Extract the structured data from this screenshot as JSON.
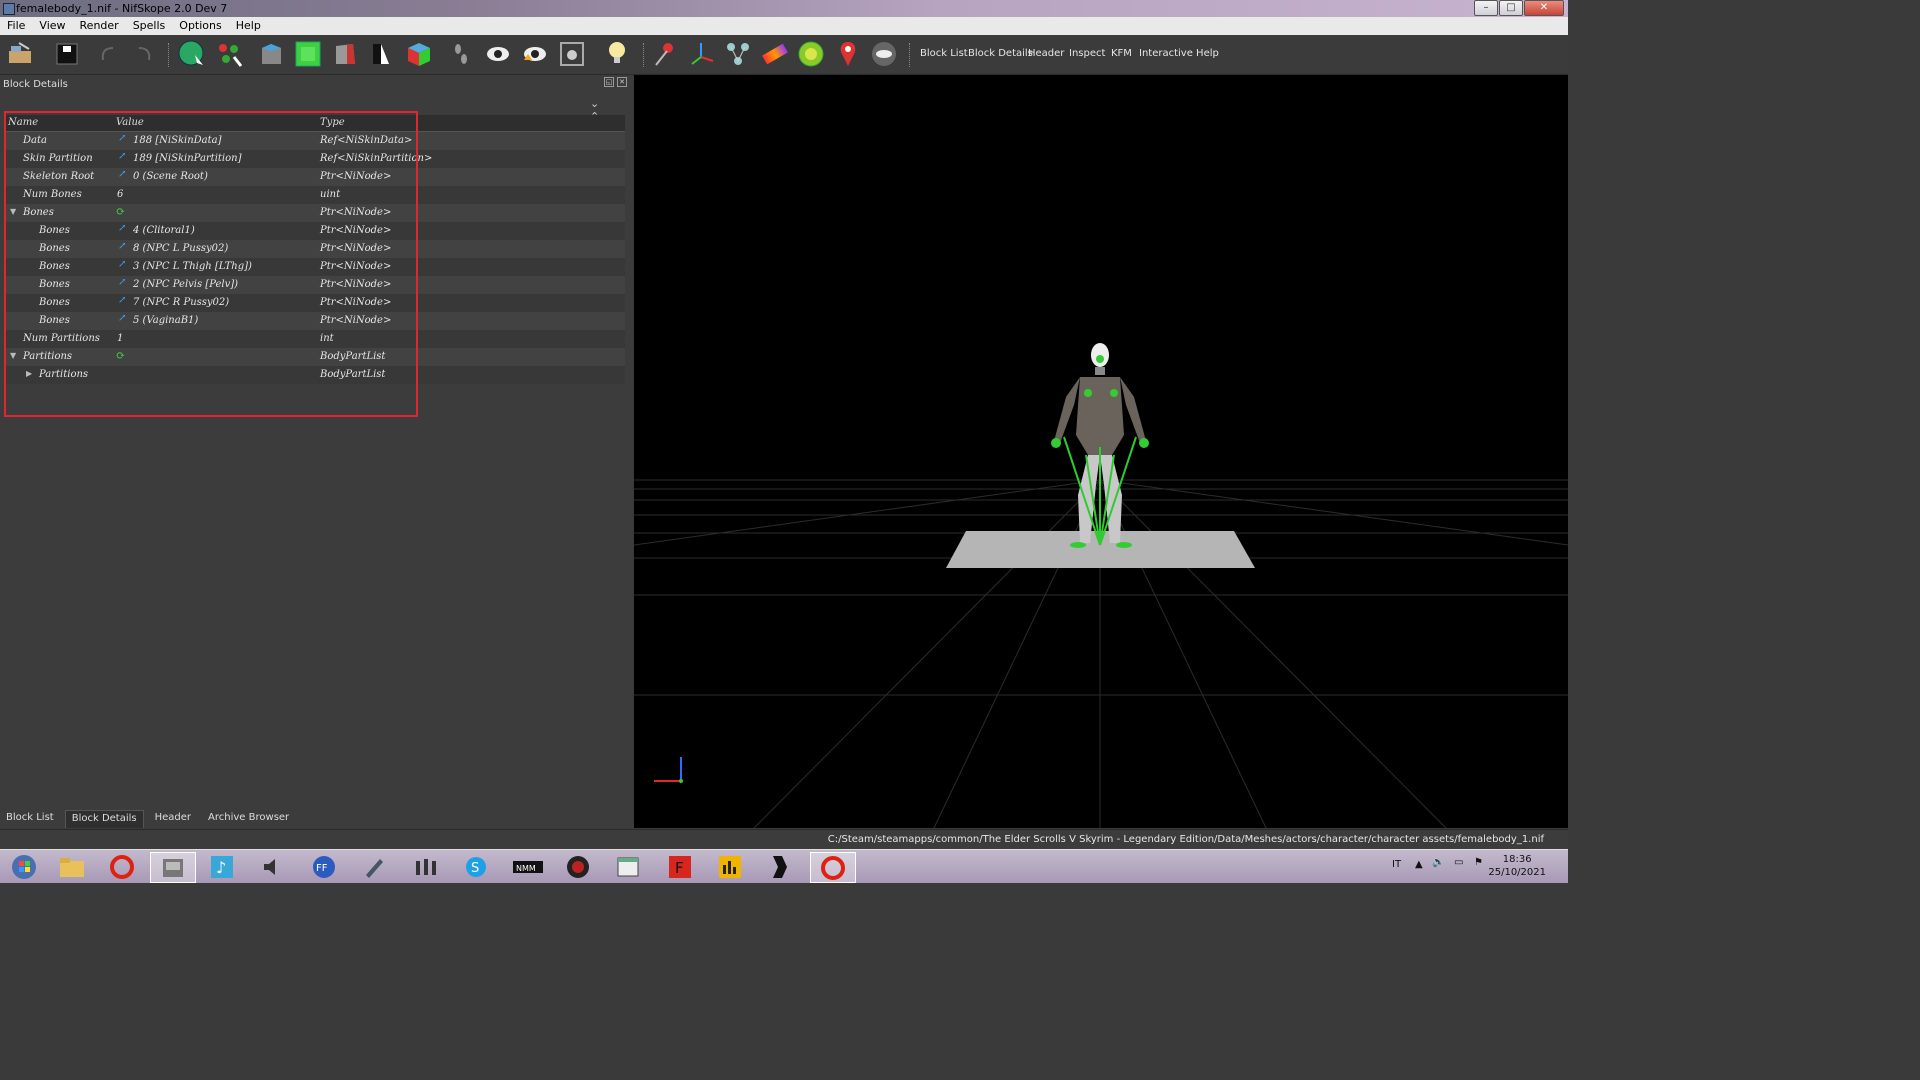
{
  "window": {
    "title": "femalebody_1.nif - NifSkope 2.0 Dev 7"
  },
  "menu": [
    "File",
    "View",
    "Render",
    "Spells",
    "Options",
    "Help"
  ],
  "toolbar": {
    "icons": [
      "load-icon",
      "save-icon",
      "undo-icon",
      "redo-icon",
      "select-object-icon",
      "select-vertex-icon",
      "cube-blue-icon",
      "cube-green-icon",
      "cube-red-icon",
      "lightning-icon",
      "cube-color-icon",
      "footprints-icon",
      "eye-icon",
      "eye-orange-icon",
      "camera-icon",
      "light-bulb-icon",
      "pin-icon",
      "axes-icon",
      "nodes-icon",
      "gradient-icon",
      "sphere-icon",
      "marker-icon",
      "visibility-icon"
    ],
    "links": [
      "Block List",
      "Block Details",
      "Header",
      "Inspect",
      "KFM",
      "Interactive Help"
    ]
  },
  "panel": {
    "title": "Block Details",
    "columns": {
      "name": "Name",
      "value": "Value",
      "type": "Type"
    },
    "rows": [
      {
        "name": "Data",
        "value": "188 [NiSkinData]",
        "type": "Ref<NiSkinData>",
        "icon": "link",
        "depth": 0
      },
      {
        "name": "Skin Partition",
        "value": "189 [NiSkinPartition]",
        "type": "Ref<NiSkinPartition>",
        "icon": "link",
        "depth": 0
      },
      {
        "name": "Skeleton Root",
        "value": "0 (Scene Root)",
        "type": "Ptr<NiNode>",
        "icon": "link",
        "depth": 0
      },
      {
        "name": "Num Bones",
        "value": "6",
        "type": "uint",
        "icon": "",
        "depth": 0
      },
      {
        "name": "Bones",
        "value": "",
        "type": "Ptr<NiNode>",
        "icon": "refresh",
        "depth": 0,
        "expanded": "open"
      },
      {
        "name": "Bones",
        "value": "4 (Clitoral1)",
        "type": "Ptr<NiNode>",
        "icon": "link",
        "depth": 1
      },
      {
        "name": "Bones",
        "value": "8 (NPC L Pussy02)",
        "type": "Ptr<NiNode>",
        "icon": "link",
        "depth": 1
      },
      {
        "name": "Bones",
        "value": "3 (NPC L Thigh [LThg])",
        "type": "Ptr<NiNode>",
        "icon": "link",
        "depth": 1
      },
      {
        "name": "Bones",
        "value": "2 (NPC Pelvis [Pelv])",
        "type": "Ptr<NiNode>",
        "icon": "link",
        "depth": 1
      },
      {
        "name": "Bones",
        "value": "7 (NPC R Pussy02)",
        "type": "Ptr<NiNode>",
        "icon": "link",
        "depth": 1
      },
      {
        "name": "Bones",
        "value": "5 (VaginaB1)",
        "type": "Ptr<NiNode>",
        "icon": "link",
        "depth": 1
      },
      {
        "name": "Num Partitions",
        "value": "1",
        "type": "int",
        "icon": "",
        "depth": 0
      },
      {
        "name": "Partitions",
        "value": "",
        "type": "BodyPartList",
        "icon": "refresh",
        "depth": 0,
        "expanded": "open"
      },
      {
        "name": "Partitions",
        "value": "",
        "type": "BodyPartList",
        "icon": "",
        "depth": 1,
        "expanded": "closed"
      }
    ]
  },
  "bottom_tabs": [
    "Block List",
    "Block Details",
    "Header",
    "Archive Browser"
  ],
  "active_bottom_tab": "Block Details",
  "status": {
    "path": "C:/Steam/steamapps/common/The Elder Scrolls V Skyrim - Legendary Edition/Data/Meshes/actors/character/character assets/femalebody_1.nif"
  },
  "taskbar": {
    "apps": [
      "start-icon",
      "explorer-icon",
      "opera-icon",
      "app-icon",
      "music-icon",
      "speaker-icon",
      "ffdec-icon",
      "pen-icon",
      "people-icon",
      "skype-icon",
      "nmm-icon",
      "gear-app-icon",
      "window-icon",
      "f-app-icon",
      "chart-app-icon",
      "arrow-app-icon",
      "opera-icon-2"
    ],
    "lang": "IT",
    "time": "18:36",
    "date": "25/10/2021"
  }
}
